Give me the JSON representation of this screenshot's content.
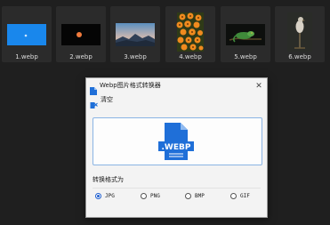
{
  "files": [
    {
      "name": "1.webp"
    },
    {
      "name": "2.webp"
    },
    {
      "name": "3.webp"
    },
    {
      "name": "4.webp"
    },
    {
      "name": "5.webp"
    },
    {
      "name": "6.webp"
    }
  ],
  "dialog": {
    "title": "Webp图片格式转换器",
    "close_glyph": "✕",
    "toolbar_label": "清空",
    "drop_icon_label": ".WEBP",
    "group_title": "转换格式为",
    "formats": [
      {
        "label": "JPG",
        "selected": true
      },
      {
        "label": "PNG",
        "selected": false
      },
      {
        "label": "BMP",
        "selected": false
      },
      {
        "label": "GIF",
        "selected": false
      }
    ]
  },
  "colors": {
    "accent": "#1f6fd8",
    "thumb_blue": "#1e88e5",
    "orange": "#f0822a"
  }
}
